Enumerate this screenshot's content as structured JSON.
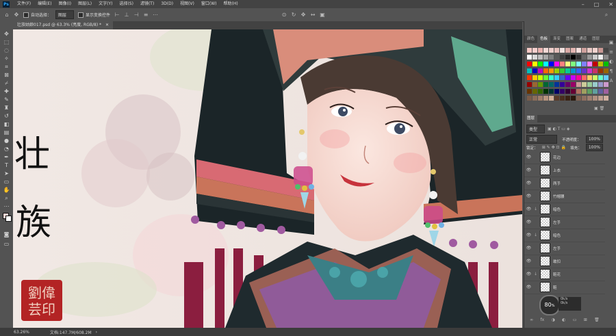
{
  "app": {
    "logo": "Ps"
  },
  "menubar": {
    "items": [
      "文件(F)",
      "编辑(E)",
      "图像(I)",
      "图层(L)",
      "文字(Y)",
      "选择(S)",
      "滤镜(T)",
      "3D(D)",
      "视图(V)",
      "窗口(W)",
      "帮助(H)"
    ]
  },
  "options": {
    "auto_select_label": "自动选择：",
    "auto_select_value": "图层",
    "show_transform_label": "显示变换控件"
  },
  "document": {
    "tab_title": "壮族姑娘017.psd @ 63.3% (亮度, RGB/8) *"
  },
  "canvas_art": {
    "title_chars": [
      "壮",
      "族"
    ],
    "seal_chars": [
      "劉",
      "偉",
      "芸",
      "印"
    ]
  },
  "status": {
    "zoom": "63.26%",
    "doc_size": "文档:147.7M/608.2M"
  },
  "panel_top": {
    "tabs": [
      "颜色",
      "色板",
      "渐变",
      "图案",
      "通道",
      "图层"
    ],
    "active": 1
  },
  "layers_panel": {
    "tab": "图层",
    "kind": "类型",
    "blend": "正常",
    "opacity_label": "不透明度：",
    "opacity": "100%",
    "lock_label": "锁定：",
    "fill_label": "填充：",
    "fill": "100%",
    "layers": [
      "花边",
      "上衣",
      "两手",
      "竹帽腰",
      "暗色",
      "左手",
      "暗色",
      "左手",
      "敢扣",
      "鞋花",
      "鞋"
    ]
  },
  "indicator": {
    "value": "80",
    "unit": "%",
    "r1": "0k/s",
    "r2": "0k/s"
  },
  "colors": {
    "accent": "#31a8ff",
    "panel": "#535353",
    "dark": "#424242"
  }
}
